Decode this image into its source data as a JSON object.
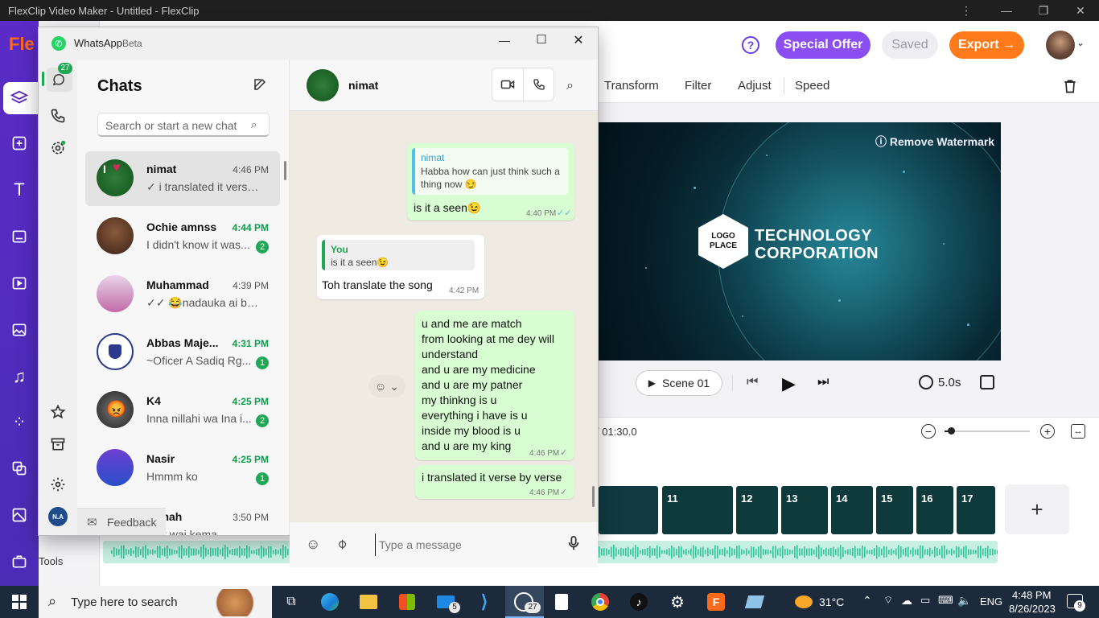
{
  "flexclip": {
    "window_title": "FlexClip Video Maker - Untitled - FlexClip",
    "logo_text": "Fle",
    "header": {
      "special_offer": "Special Offer",
      "saved": "Saved",
      "export": "Export →"
    },
    "toolbar": [
      "Transform",
      "Filter",
      "Adjust",
      "Speed"
    ],
    "preview": {
      "remove_watermark": "Remove Watermark",
      "logo_line1": "LOGO",
      "logo_line2": "PLACE",
      "headline1": "TECHNOLOGY",
      "headline2": "CORPORATION"
    },
    "controls": {
      "scene": "Scene 01",
      "duration": "5.0s",
      "total_time": "/ 01:30.0"
    },
    "zoom_level": 0.08,
    "clips": [
      {
        "num": "11"
      },
      {
        "num": "12"
      },
      {
        "num": "13"
      },
      {
        "num": "14"
      },
      {
        "num": "15"
      },
      {
        "num": "16"
      },
      {
        "num": "17"
      }
    ],
    "tools_label": "Tools"
  },
  "whatsapp": {
    "title": "WhatsApp",
    "beta": "Beta",
    "nav_badge": "27",
    "user_initials": "N.A",
    "chats_heading": "Chats",
    "search_placeholder": "Search or start a new chat",
    "feedback": "Feedback",
    "chats": [
      {
        "name": "nimat",
        "time": "4:46 PM",
        "preview": "✓ i translated it verse by verse",
        "unread": "",
        "green": false
      },
      {
        "name": "Ochie amnss",
        "time": "4:44 PM",
        "preview": "I didn't know it was...",
        "unread": "2",
        "green": true
      },
      {
        "name": "Muhammad",
        "time": "4:39 PM",
        "preview": "✓✓ 😂nadauka ai ba...",
        "unread": "",
        "green": false
      },
      {
        "name": "Abbas Maje...",
        "time": "4:31 PM",
        "preview": "~Oficer A Sadiq Rg...",
        "unread": "1",
        "green": true
      },
      {
        "name": "K4",
        "time": "4:25 PM",
        "preview": "Inna nillahi wa Ina i...",
        "unread": "2",
        "green": true
      },
      {
        "name": "Nasir",
        "time": "4:25 PM",
        "preview": "Hmmm ko",
        "unread": "1",
        "green": true
      },
      {
        "name": "eemah",
        "time": "3:50 PM",
        "preview": "wait wai kema",
        "unread": "",
        "green": false
      }
    ],
    "conversation": {
      "contact": "nimat",
      "messages": {
        "m1_quote_author": "nimat",
        "m1_quote_text": "Habba how can just think such a thing now 😏",
        "m1_text": "is it a seen😉",
        "m1_time": "4:40 PM",
        "m2_quote_author": "You",
        "m2_quote_text": "is it a seen😉",
        "m2_text": "Toh translate the song",
        "m2_time": "4:42 PM",
        "m3_lines": [
          "u and me are match",
          "from looking at me dey will",
          "understand",
          "and u are my medicine",
          "and u are my patner",
          "my thinkng is u",
          "everything i have is  u",
          "inside my blood is u",
          "and u are my king"
        ],
        "m3_time": "4:46 PM",
        "m4_text": "i translated it verse by verse",
        "m4_time": "4:46 PM"
      },
      "compose_placeholder": "Type a message"
    }
  },
  "taskbar": {
    "search_placeholder": "Type here to search",
    "mail_badge": "5",
    "whatsapp_badge": "27",
    "weather": "31°C",
    "language": "ENG",
    "time": "4:48 PM",
    "date": "8/26/2023",
    "notifications": "9"
  },
  "colors": {
    "flexclip_purple": "#5a2bc7",
    "special_offer": "#8b4ef0",
    "export_orange": "#ff7a1a",
    "whatsapp_green": "#1fa855",
    "outgoing_bubble": "#d9fdd3"
  }
}
